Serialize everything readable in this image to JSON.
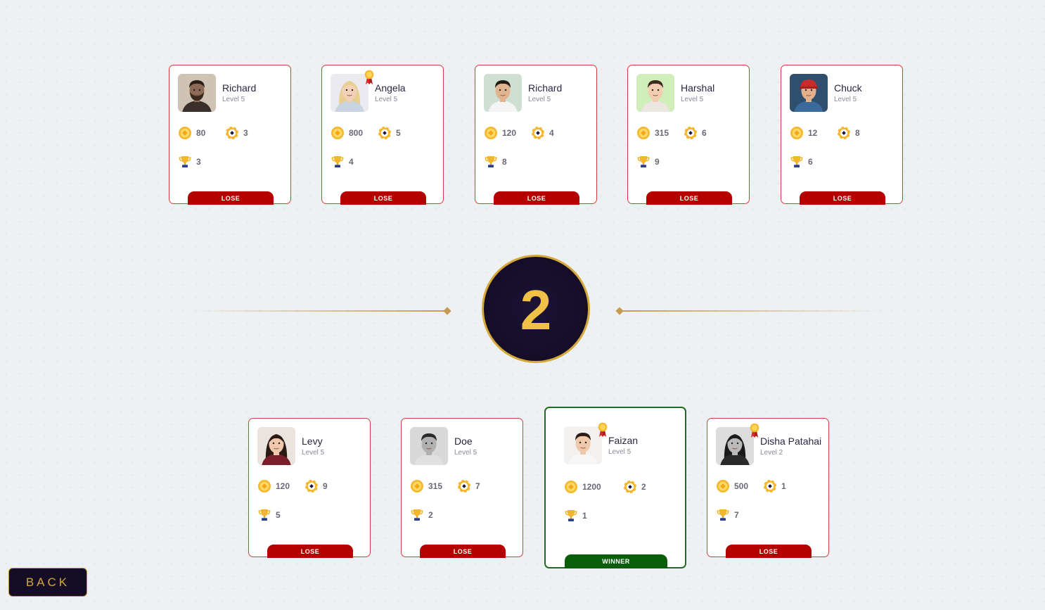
{
  "round": {
    "number": "2"
  },
  "back_label": "BACK",
  "colors": {
    "lose": "#b50000",
    "winner": "#0a5e0a",
    "gold": "#d4a83a",
    "card_border": "#d43c3c"
  },
  "top_players": [
    {
      "name": "Richard",
      "level": "Level 5",
      "coins": "80",
      "chips": "3",
      "trophies": "3",
      "result": "LOSE",
      "avatar": "avatar-man-beard",
      "has_badge": false
    },
    {
      "name": "Angela",
      "level": "Level 5",
      "coins": "800",
      "chips": "5",
      "trophies": "4",
      "result": "LOSE",
      "avatar": "avatar-woman-blonde",
      "has_badge": true
    },
    {
      "name": "Richard",
      "level": "Level 5",
      "coins": "120",
      "chips": "4",
      "trophies": "8",
      "result": "LOSE",
      "avatar": "avatar-man-white-shirt",
      "has_badge": false
    },
    {
      "name": "Harshal",
      "level": "Level 5",
      "coins": "315",
      "chips": "6",
      "trophies": "9",
      "result": "LOSE",
      "avatar": "avatar-man-green-bg",
      "has_badge": false
    },
    {
      "name": "Chuck",
      "level": "Level 5",
      "coins": "12",
      "chips": "8",
      "trophies": "6",
      "result": "LOSE",
      "avatar": "avatar-man-red-cap",
      "has_badge": false
    }
  ],
  "bottom_players": [
    {
      "name": "Levy",
      "level": "Level 5",
      "coins": "120",
      "chips": "9",
      "trophies": "5",
      "result": "LOSE",
      "avatar": "avatar-woman-dark-hair",
      "has_badge": false
    },
    {
      "name": "Doe",
      "level": "Level 5",
      "coins": "315",
      "chips": "7",
      "trophies": "2",
      "result": "LOSE",
      "avatar": "avatar-man-bw",
      "has_badge": false
    },
    {
      "name": "Faizan",
      "level": "Level 5",
      "coins": "1200",
      "chips": "2",
      "trophies": "1",
      "result": "WINNER",
      "avatar": "avatar-man-smiling",
      "has_badge": true
    },
    {
      "name": "Disha Patahai",
      "level": "Level 2",
      "coins": "500",
      "chips": "1",
      "trophies": "7",
      "result": "LOSE",
      "avatar": "avatar-woman-bw",
      "has_badge": true
    }
  ]
}
